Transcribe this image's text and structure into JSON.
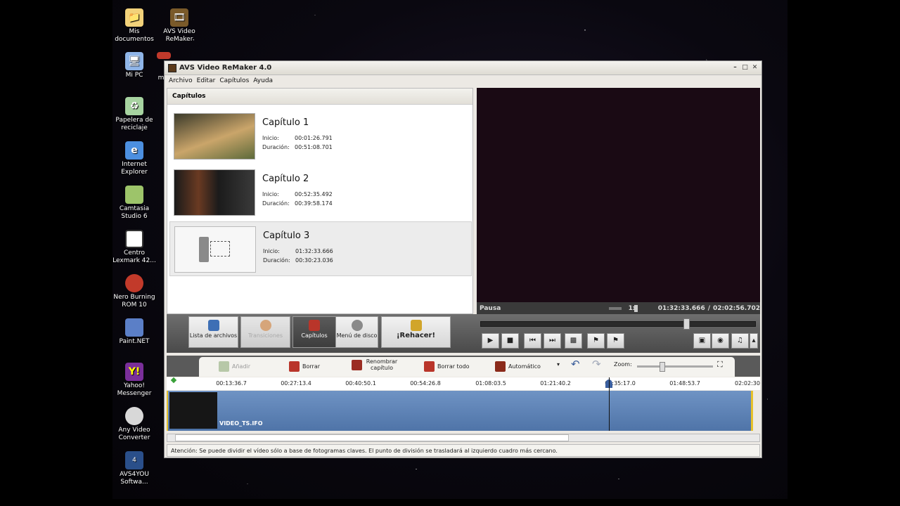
{
  "desktop_icons": [
    {
      "label": "Mis documentos",
      "icon": "folder-icon",
      "color": "#f2d27a"
    },
    {
      "label": "AVS Video ReMaker",
      "icon": "film-icon",
      "color": "#7a5a2a"
    },
    {
      "label": "Mi PC",
      "icon": "computer-icon",
      "color": "#8fb5e8"
    },
    {
      "label": "Papelera de reciclaje",
      "icon": "recycle-bin-icon",
      "color": "#a7d3a1"
    },
    {
      "label": "Internet Explorer",
      "icon": "ie-icon",
      "color": "#4c8fe0"
    },
    {
      "label": "Camtasia Studio 6",
      "icon": "camtasia-icon",
      "color": "#9dc46a"
    },
    {
      "label": "Centro Lexmark 42...",
      "icon": "lexmark-icon",
      "color": "#ffffff"
    },
    {
      "label": "Nero Burning ROM 10",
      "icon": "nero-icon",
      "color": "#c23a2a"
    },
    {
      "label": "Paint.NET",
      "icon": "paint-icon",
      "color": "#5b7fc7"
    },
    {
      "label": "Yahoo! Messenger",
      "icon": "yahoo-icon",
      "color": "#7a2f9a"
    },
    {
      "label": "Any Video Converter",
      "icon": "converter-icon",
      "color": "#d8d8d8"
    },
    {
      "label": "AVS4YOU Softwa...",
      "icon": "avs4you-icon",
      "color": "#2a4f8a"
    }
  ],
  "desktop_partial_label": "m",
  "window": {
    "title": "AVS Video ReMaker 4.0",
    "controls": [
      "–",
      "□",
      "✕"
    ]
  },
  "menu": [
    "Archivo",
    "Editar",
    "Capítulos",
    "Ayuda"
  ],
  "chapters_panel": {
    "header": "Capítulos",
    "start_label": "Inicio:",
    "duration_label": "Duración:",
    "items": [
      {
        "title": "Capítulo 1",
        "start": "00:01:26.791",
        "duration": "00:51:08.701"
      },
      {
        "title": "Capítulo 2",
        "start": "00:52:35.492",
        "duration": "00:39:58.174"
      },
      {
        "title": "Capítulo 3",
        "start": "01:32:33.666",
        "duration": "00:30:23.036"
      }
    ]
  },
  "player": {
    "status": "Pausa",
    "speed": "1x",
    "current_time": "01:32:33.666",
    "separator": "/",
    "total_time": "02:02:56.702",
    "position": 0.75
  },
  "toolbar": {
    "lista": "Lista de archivos",
    "transiciones": "Transiciones",
    "capitulos": "Capítulos",
    "menu_disco": "Menú de disco",
    "rehacer": "¡Rehacer!"
  },
  "timeline_toolbar": {
    "anadir": "Añadir",
    "borrar": "Borrar",
    "renombrar": "Renombrar capítulo",
    "borrar_todo": "Borrar todo",
    "automatico": "Automático",
    "zoom_label": "Zoom:"
  },
  "ruler_ticks": [
    "00:13:36.7",
    "00:27:13.4",
    "00:40:50.1",
    "00:54:26.8",
    "01:08:03.5",
    "01:21:40.2",
    "01:35:17.0",
    "01:48:53.7",
    "02:02:30"
  ],
  "track_label": "VIDEO_TS.IFO",
  "status_message": "Atención: Se puede dividir el vídeo sólo a base de fotogramas claves. El punto de división se trasladará al izquierdo cuadro más cercano."
}
